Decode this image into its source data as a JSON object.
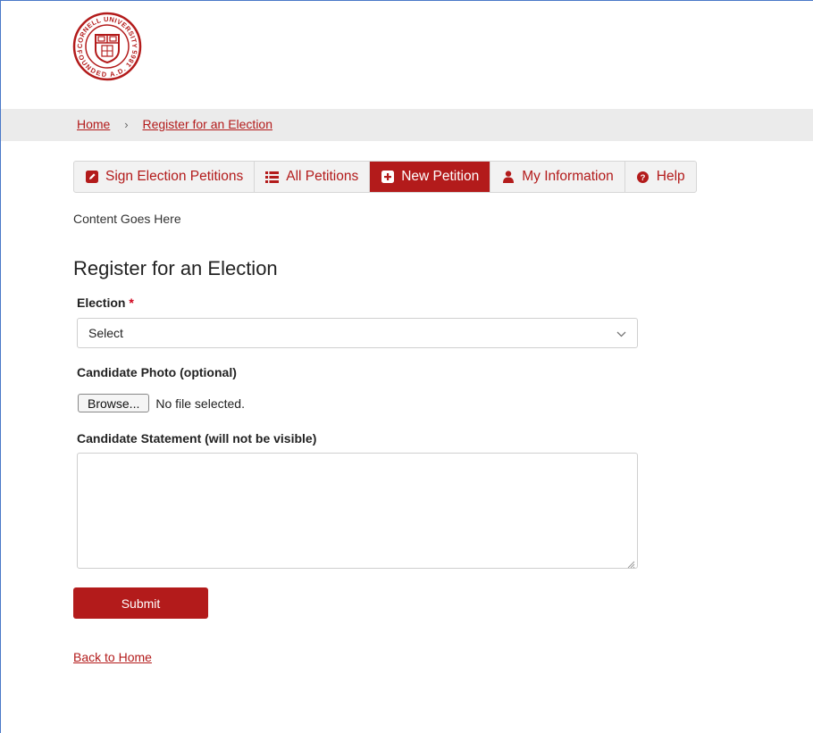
{
  "logo": {
    "ring_top_text": "CORNELL UNIVERSITY",
    "ring_bottom_text": "FOUNDED A.D. 1865",
    "icon": "university-seal"
  },
  "breadcrumb": {
    "home": "Home",
    "separator": "›",
    "current": "Register for an Election"
  },
  "tabs": [
    {
      "label": "Sign Election Petitions",
      "icon": "pencil-square-icon",
      "active": false
    },
    {
      "label": "All Petitions",
      "icon": "list-icon",
      "active": false
    },
    {
      "label": "New Petition",
      "icon": "plus-square-icon",
      "active": true
    },
    {
      "label": "My Information",
      "icon": "user-icon",
      "active": false
    },
    {
      "label": "Help",
      "icon": "question-circle-icon",
      "active": false
    }
  ],
  "content_note": "Content Goes Here",
  "form": {
    "title": "Register for an Election",
    "election_label": "Election",
    "required_mark": "*",
    "election_selected": "Select",
    "photo_label": "Candidate Photo (optional)",
    "browse_label": "Browse...",
    "file_status": "No file selected.",
    "statement_label": "Candidate Statement (will not be visible)",
    "statement_value": "",
    "submit_label": "Submit"
  },
  "back_link": "Back to Home",
  "colors": {
    "accent": "#b31b1b",
    "breadcrumb_bg": "#ebebeb",
    "tab_bg": "#f2f2f2"
  }
}
